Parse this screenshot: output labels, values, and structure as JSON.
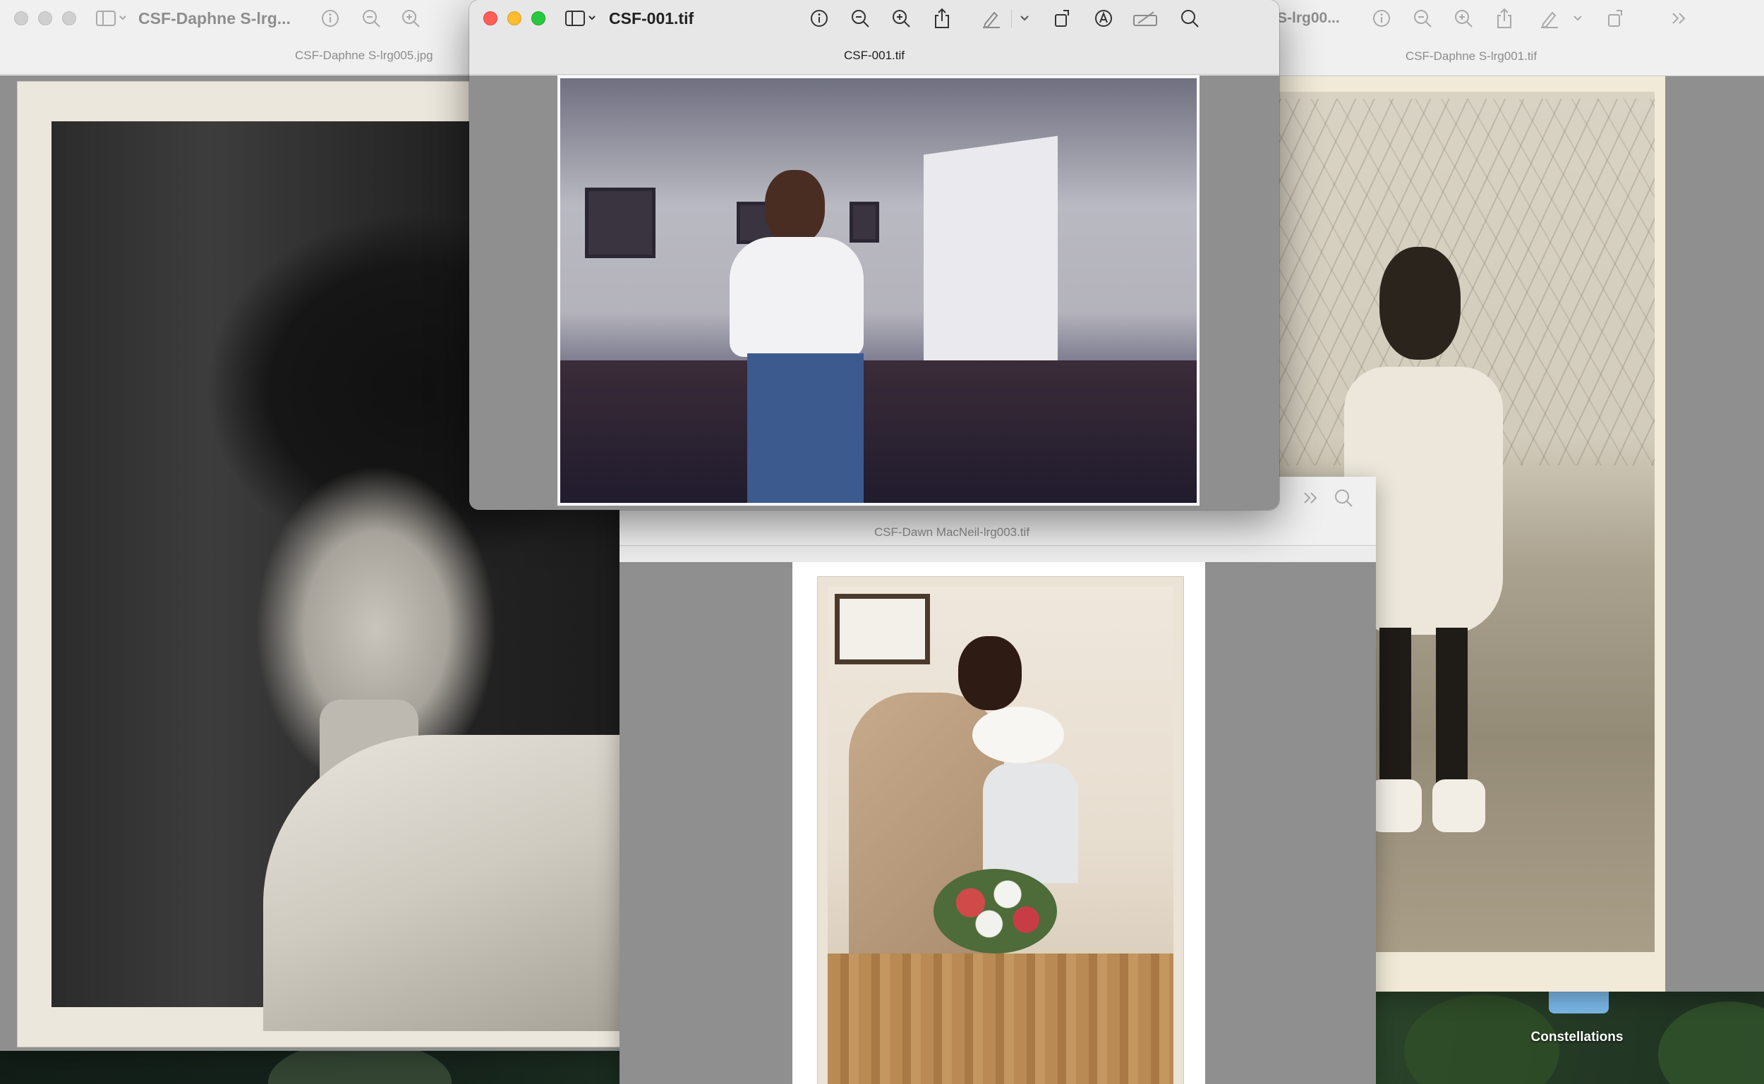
{
  "desktop": {
    "widget_label": "Constellations"
  },
  "windows": {
    "daphne005": {
      "title": "CSF-Daphne S-lrg...",
      "tab": "CSF-Daphne S-lrg005.jpg"
    },
    "csf001": {
      "title": "CSF-001.tif",
      "tab": "CSF-001.tif"
    },
    "daphne001": {
      "title": "S-lrg00...",
      "tab": "CSF-Daphne S-lrg001.tif"
    },
    "dawn003": {
      "tab": "CSF-Dawn MacNeil-lrg003.tif"
    }
  },
  "icons": {
    "sidebar": "sidebar-icon",
    "info": "info-icon",
    "zoom_out": "zoom-out-icon",
    "zoom_in": "zoom-in-icon",
    "share": "share-icon",
    "markup": "pencil-icon",
    "rotate": "rotate-icon",
    "annotate": "annotate-icon",
    "redact": "redact-icon",
    "search": "search-icon",
    "more": "chevron-double-right-icon"
  },
  "colors": {
    "close": "#ff5f57",
    "minimize": "#febc2e",
    "zoom": "#28c840",
    "canvas": "#8f8f8f"
  }
}
